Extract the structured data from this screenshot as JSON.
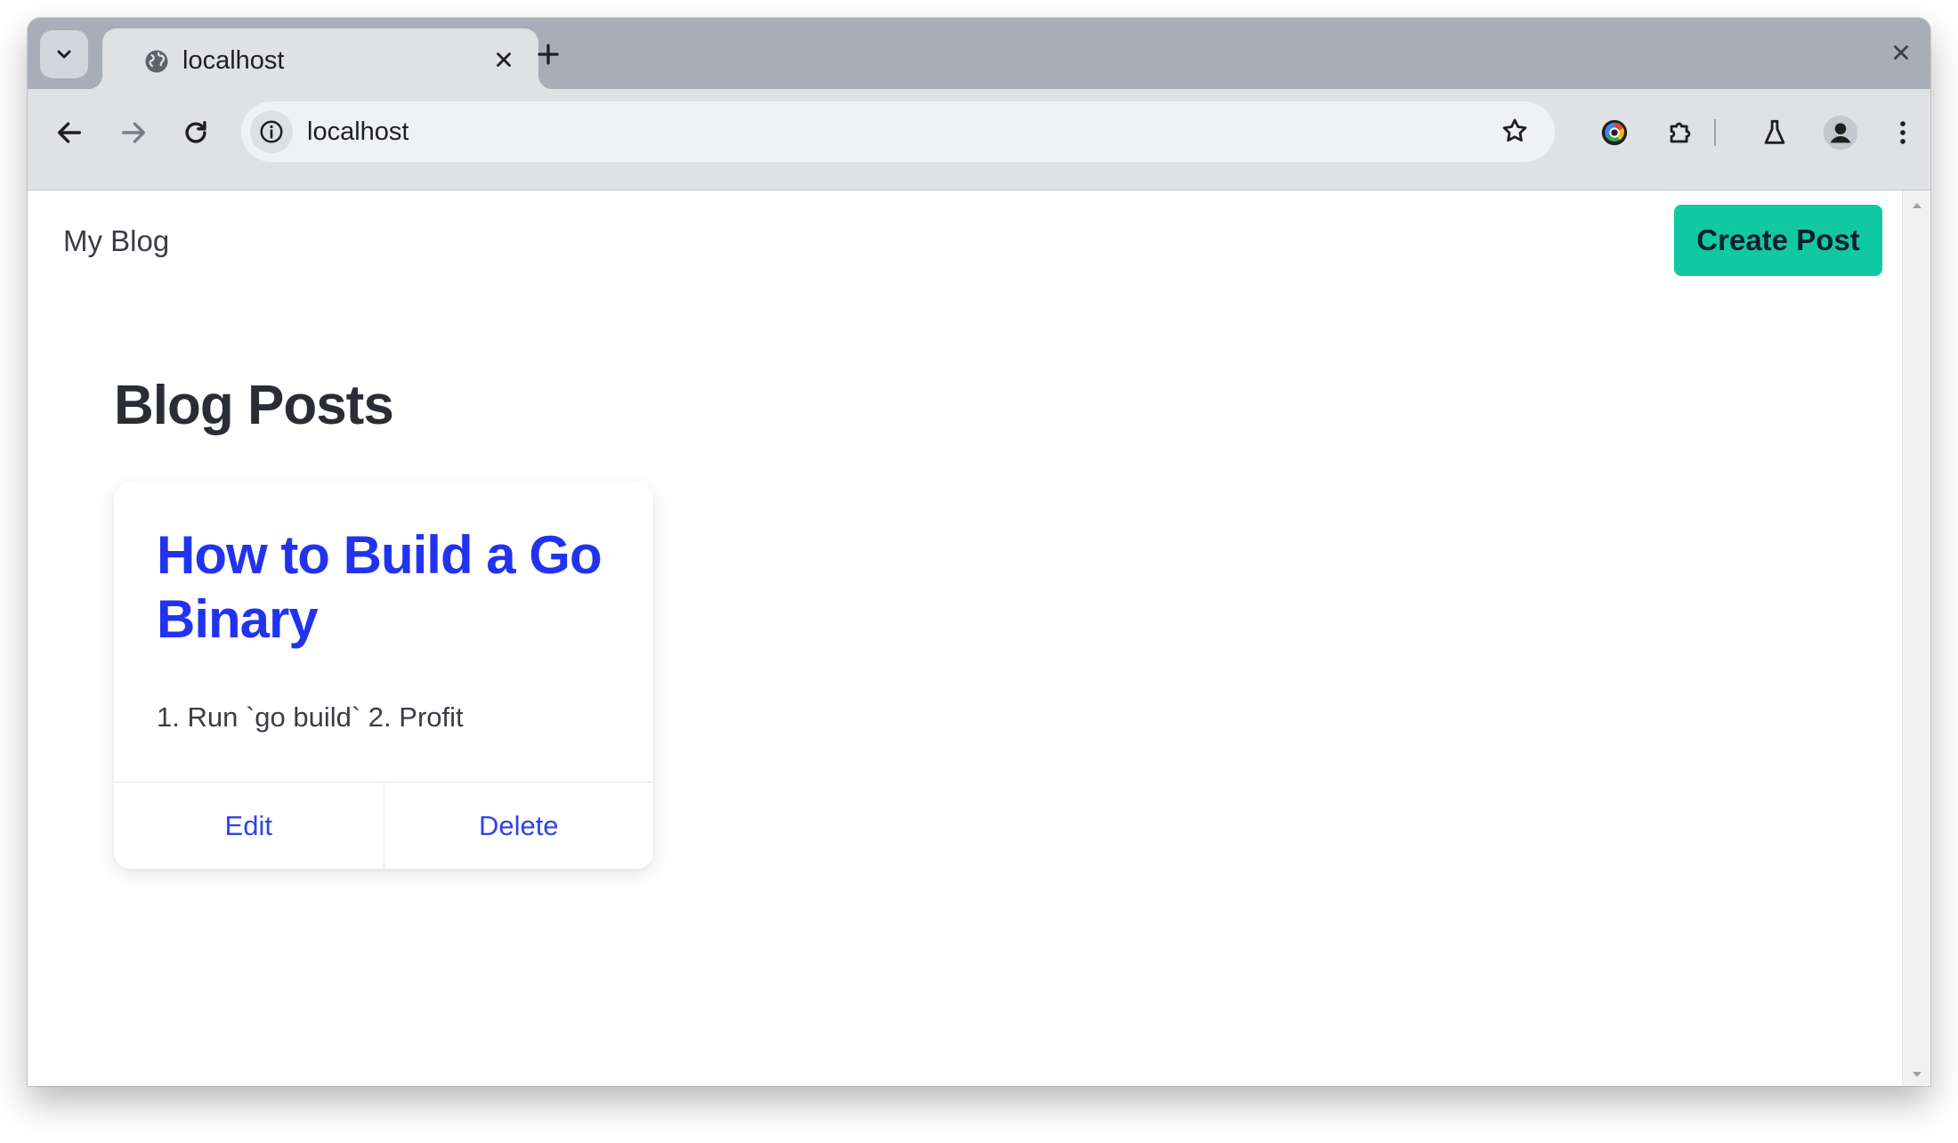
{
  "browser": {
    "tab": {
      "title": "localhost",
      "favicon": "globe-icon"
    },
    "address_bar": {
      "url": "localhost"
    },
    "icons": [
      "tab-search-icon",
      "globe-icon",
      "close-icon",
      "plus-icon",
      "close-window-icon",
      "back-arrow-icon",
      "forward-arrow-icon",
      "reload-icon",
      "info-icon",
      "star-icon",
      "color-extension-icon",
      "puzzle-icon",
      "flask-icon",
      "profile-icon",
      "more-vert-icon"
    ]
  },
  "page": {
    "header": {
      "brand": "My Blog",
      "create_button": "Create Post"
    },
    "heading": "Blog Posts",
    "posts": [
      {
        "title": "How to Build a Go Binary",
        "body": "1. Run `go build` 2. Profit",
        "actions": {
          "edit": "Edit",
          "delete": "Delete"
        }
      }
    ]
  },
  "colors": {
    "accent_button": "#10c9a3",
    "link_blue": "#2233f0",
    "action_blue": "#2f45e6",
    "tabstrip": "#a9adb8",
    "toolbar": "#dfe1e5"
  }
}
